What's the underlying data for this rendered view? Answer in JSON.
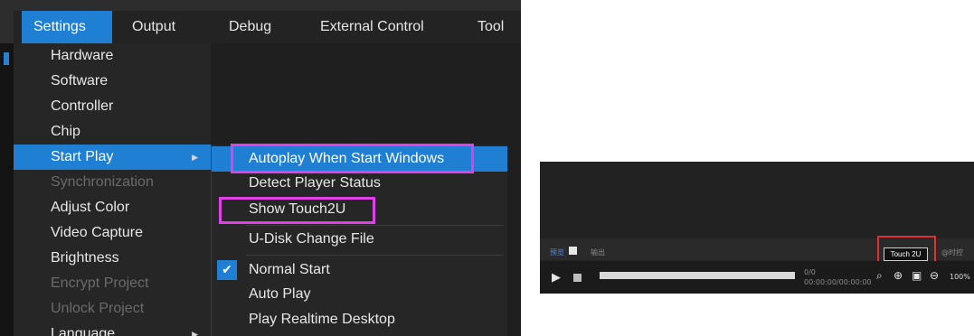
{
  "menubar": {
    "items": [
      "Settings",
      "Output",
      "Debug",
      "External Control",
      "Tool"
    ]
  },
  "settings_menu": {
    "items": [
      {
        "label": "Hardware",
        "enabled": true
      },
      {
        "label": "Software",
        "enabled": true
      },
      {
        "label": "Controller",
        "enabled": true
      },
      {
        "label": "Chip",
        "enabled": true
      },
      {
        "label": "Start Play",
        "enabled": true,
        "has_submenu": true,
        "active": true
      },
      {
        "label": "Synchronization",
        "enabled": false
      },
      {
        "label": "Adjust Color",
        "enabled": true
      },
      {
        "label": "Video Capture",
        "enabled": true
      },
      {
        "label": "Brightness",
        "enabled": true
      },
      {
        "label": "Encrypt Project",
        "enabled": false
      },
      {
        "label": "Unlock Project",
        "enabled": false
      },
      {
        "label": "Language",
        "enabled": true,
        "has_submenu": true
      }
    ]
  },
  "start_play_submenu": {
    "items": [
      {
        "label": "Autoplay When Start Windows",
        "active": true,
        "highlighted": true
      },
      {
        "label": "Detect Player Status"
      },
      {
        "label": "Show Touch2U",
        "highlighted": true
      },
      {
        "label": "U-Disk Change File"
      },
      {
        "label": "Normal Start",
        "checked": true
      },
      {
        "label": "Auto Play"
      },
      {
        "label": "Play Realtime Desktop"
      }
    ]
  },
  "player": {
    "tab_preview": "预览",
    "tab_output": "输出",
    "touch_button": "Touch 2U",
    "tab_timing": "@时控",
    "counter": "0/0",
    "time": "00:00:00/00:00:00",
    "zoom": "100%"
  },
  "colors": {
    "accent": "#1e7fd3",
    "highlight_magenta": "#e040e8",
    "highlight_red": "#e03030"
  }
}
